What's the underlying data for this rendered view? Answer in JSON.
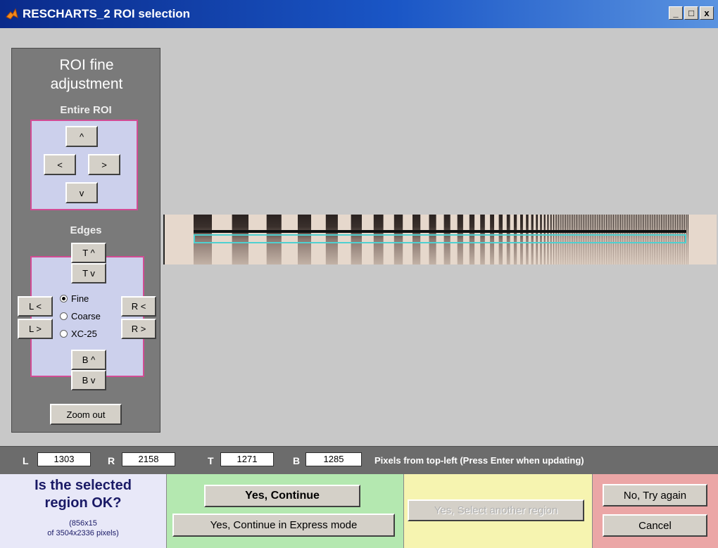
{
  "window": {
    "title": "RESCHARTS_2 ROI selection",
    "buttons": {
      "minimize": "_",
      "maximize": "□",
      "close": "x"
    }
  },
  "side_panel": {
    "title": "ROI fine adjustment",
    "entire_roi": {
      "label": "Entire ROI",
      "up": "^",
      "left": "<",
      "right": ">",
      "down": "v"
    },
    "edges": {
      "label": "Edges",
      "top_up": "T ^",
      "top_down": "T v",
      "left_left": "L <",
      "left_right": "L >",
      "right_left": "R <",
      "right_right": "R >",
      "bottom_up": "B ^",
      "bottom_down": "B v",
      "step_options": [
        "Fine",
        "Coarse",
        "XC-25"
      ],
      "step_selected": "Fine"
    },
    "zoom_out": "Zoom out"
  },
  "coords": {
    "L_label": "L",
    "L_value": "1303",
    "R_label": "R",
    "R_value": "2158",
    "T_label": "T",
    "T_value": "1271",
    "B_label": "B",
    "B_value": "1285",
    "hint": "Pixels from top-left  (Press Enter when updating)"
  },
  "question": {
    "title": "Is the selected region OK?",
    "details_line1": "(856x15",
    "details_line2": "of 3504x2336 pixels)"
  },
  "actions": {
    "continue": "Yes, Continue",
    "continue_express": "Yes, Continue in Express mode",
    "select_another": "Yes, Select another region",
    "try_again": "No, Try again",
    "cancel": "Cancel"
  },
  "colors": {
    "question_bg": "#e8e8f8",
    "continue_bg": "#b4e8b0",
    "select_another_bg": "#f6f4b0",
    "try_again_bg": "#eba6a6",
    "roi_highlight": "#4fd0d0",
    "box_border": "#d24c94"
  }
}
